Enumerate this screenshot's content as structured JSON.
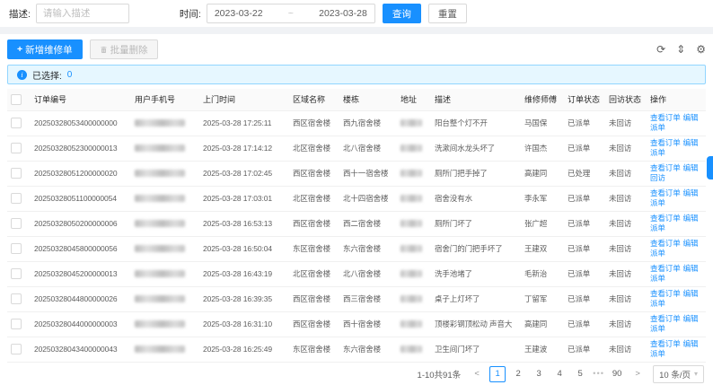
{
  "colors": {
    "primary": "#1890ff",
    "selection_bg": "#e6f7ff",
    "selection_border": "#91d5ff"
  },
  "filter": {
    "description_label": "描述:",
    "description_placeholder": "请输入描述",
    "time_label": "时间:",
    "date_start": "2023-03-22",
    "date_separator": "~",
    "date_end": "2023-03-28",
    "search_button": "查询",
    "reset_button": "重置"
  },
  "toolbar": {
    "add_button": "新增维修单",
    "plus_icon": "+",
    "batch_delete_button": "批量删除",
    "icons": {
      "reload": "⟳",
      "density": "⇕",
      "settings": "⚙"
    }
  },
  "selection_bar": {
    "info_icon": "i",
    "label": "已选择:",
    "count": "0"
  },
  "table": {
    "columns": [
      "订单编号",
      "用户手机号",
      "上门时间",
      "区域名称",
      "楼栋",
      "地址",
      "描述",
      "维修师傅",
      "订单状态",
      "回访状态",
      "操作"
    ],
    "rows": [
      {
        "order_no": "20250328053400000000",
        "phone_blurred": true,
        "visit_time": "2025-03-28 17:25:11",
        "area": "西区宿舍楼",
        "building": "西九宿舍楼",
        "address_blurred": true,
        "description": "阳台整个灯不开",
        "master": "马国保",
        "order_status": "已派单",
        "visit_status": "未回访",
        "actions": [
          "查看订单",
          "编辑",
          "派单"
        ]
      },
      {
        "order_no": "20250328052300000013",
        "phone_blurred": true,
        "visit_time": "2025-03-28 17:14:12",
        "area": "北区宿舍楼",
        "building": "北八宿舍楼",
        "address_blurred": true,
        "description": "洗漱间水龙头坏了",
        "master": "许国杰",
        "order_status": "已派单",
        "visit_status": "未回访",
        "actions": [
          "查看订单",
          "编辑",
          "派单"
        ]
      },
      {
        "order_no": "20250328051200000020",
        "phone_blurred": true,
        "visit_time": "2025-03-28 17:02:45",
        "area": "西区宿舍楼",
        "building": "西十一宿舍楼",
        "address_blurred": true,
        "description": "厕所门把手掉了",
        "master": "高建同",
        "order_status": "已处理",
        "visit_status": "未回访",
        "actions": [
          "查看订单",
          "编辑",
          "回访"
        ]
      },
      {
        "order_no": "20250328051100000054",
        "phone_blurred": true,
        "visit_time": "2025-03-28 17:03:01",
        "area": "北区宿舍楼",
        "building": "北十四宿舍楼",
        "address_blurred": true,
        "description": "宿舍没有水",
        "master": "李永军",
        "order_status": "已派单",
        "visit_status": "未回访",
        "actions": [
          "查看订单",
          "编辑",
          "派单"
        ]
      },
      {
        "order_no": "20250328050200000006",
        "phone_blurred": true,
        "visit_time": "2025-03-28 16:53:13",
        "area": "西区宿舍楼",
        "building": "西二宿舍楼",
        "address_blurred": true,
        "description": "厕所门坏了",
        "master": "张广超",
        "order_status": "已派单",
        "visit_status": "未回访",
        "actions": [
          "查看订单",
          "编辑",
          "派单"
        ]
      },
      {
        "order_no": "20250328045800000056",
        "phone_blurred": true,
        "visit_time": "2025-03-28 16:50:04",
        "area": "东区宿舍楼",
        "building": "东六宿舍楼",
        "address_blurred": true,
        "description": "宿舍门的门把手坏了",
        "master": "王建双",
        "order_status": "已派单",
        "visit_status": "未回访",
        "actions": [
          "查看订单",
          "编辑",
          "派单"
        ]
      },
      {
        "order_no": "20250328045200000013",
        "phone_blurred": true,
        "visit_time": "2025-03-28 16:43:19",
        "area": "北区宿舍楼",
        "building": "北八宿舍楼",
        "address_blurred": true,
        "description": "洗手池堵了",
        "master": "毛新治",
        "order_status": "已派单",
        "visit_status": "未回访",
        "actions": [
          "查看订单",
          "编辑",
          "派单"
        ]
      },
      {
        "order_no": "20250328044800000026",
        "phone_blurred": true,
        "visit_time": "2025-03-28 16:39:35",
        "area": "西区宿舍楼",
        "building": "西三宿舍楼",
        "address_blurred": true,
        "description": "桌子上灯坏了",
        "master": "丁留军",
        "order_status": "已派单",
        "visit_status": "未回访",
        "actions": [
          "查看订单",
          "编辑",
          "派单"
        ]
      },
      {
        "order_no": "20250328044000000003",
        "phone_blurred": true,
        "visit_time": "2025-03-28 16:31:10",
        "area": "西区宿舍楼",
        "building": "西十宿舍楼",
        "address_blurred": true,
        "description": "顶楼彩钢顶松动 声音大",
        "master": "高建同",
        "order_status": "已派单",
        "visit_status": "未回访",
        "actions": [
          "查看订单",
          "编辑",
          "派单"
        ]
      },
      {
        "order_no": "20250328043400000043",
        "phone_blurred": true,
        "visit_time": "2025-03-28 16:25:49",
        "area": "东区宿舍楼",
        "building": "东六宿舍楼",
        "address_blurred": true,
        "description": "卫生间门坏了",
        "master": "王建波",
        "order_status": "已派单",
        "visit_status": "未回访",
        "actions": [
          "查看订单",
          "编辑",
          "派单"
        ]
      }
    ]
  },
  "pagination": {
    "total": "1-10共91条",
    "prev": "<",
    "pages": [
      "1",
      "2",
      "3",
      "4",
      "5"
    ],
    "current_page": "1",
    "ellipsis": "•••",
    "last_page": "90",
    "next": ">",
    "page_size": "10 条/页",
    "caret": "▾"
  }
}
